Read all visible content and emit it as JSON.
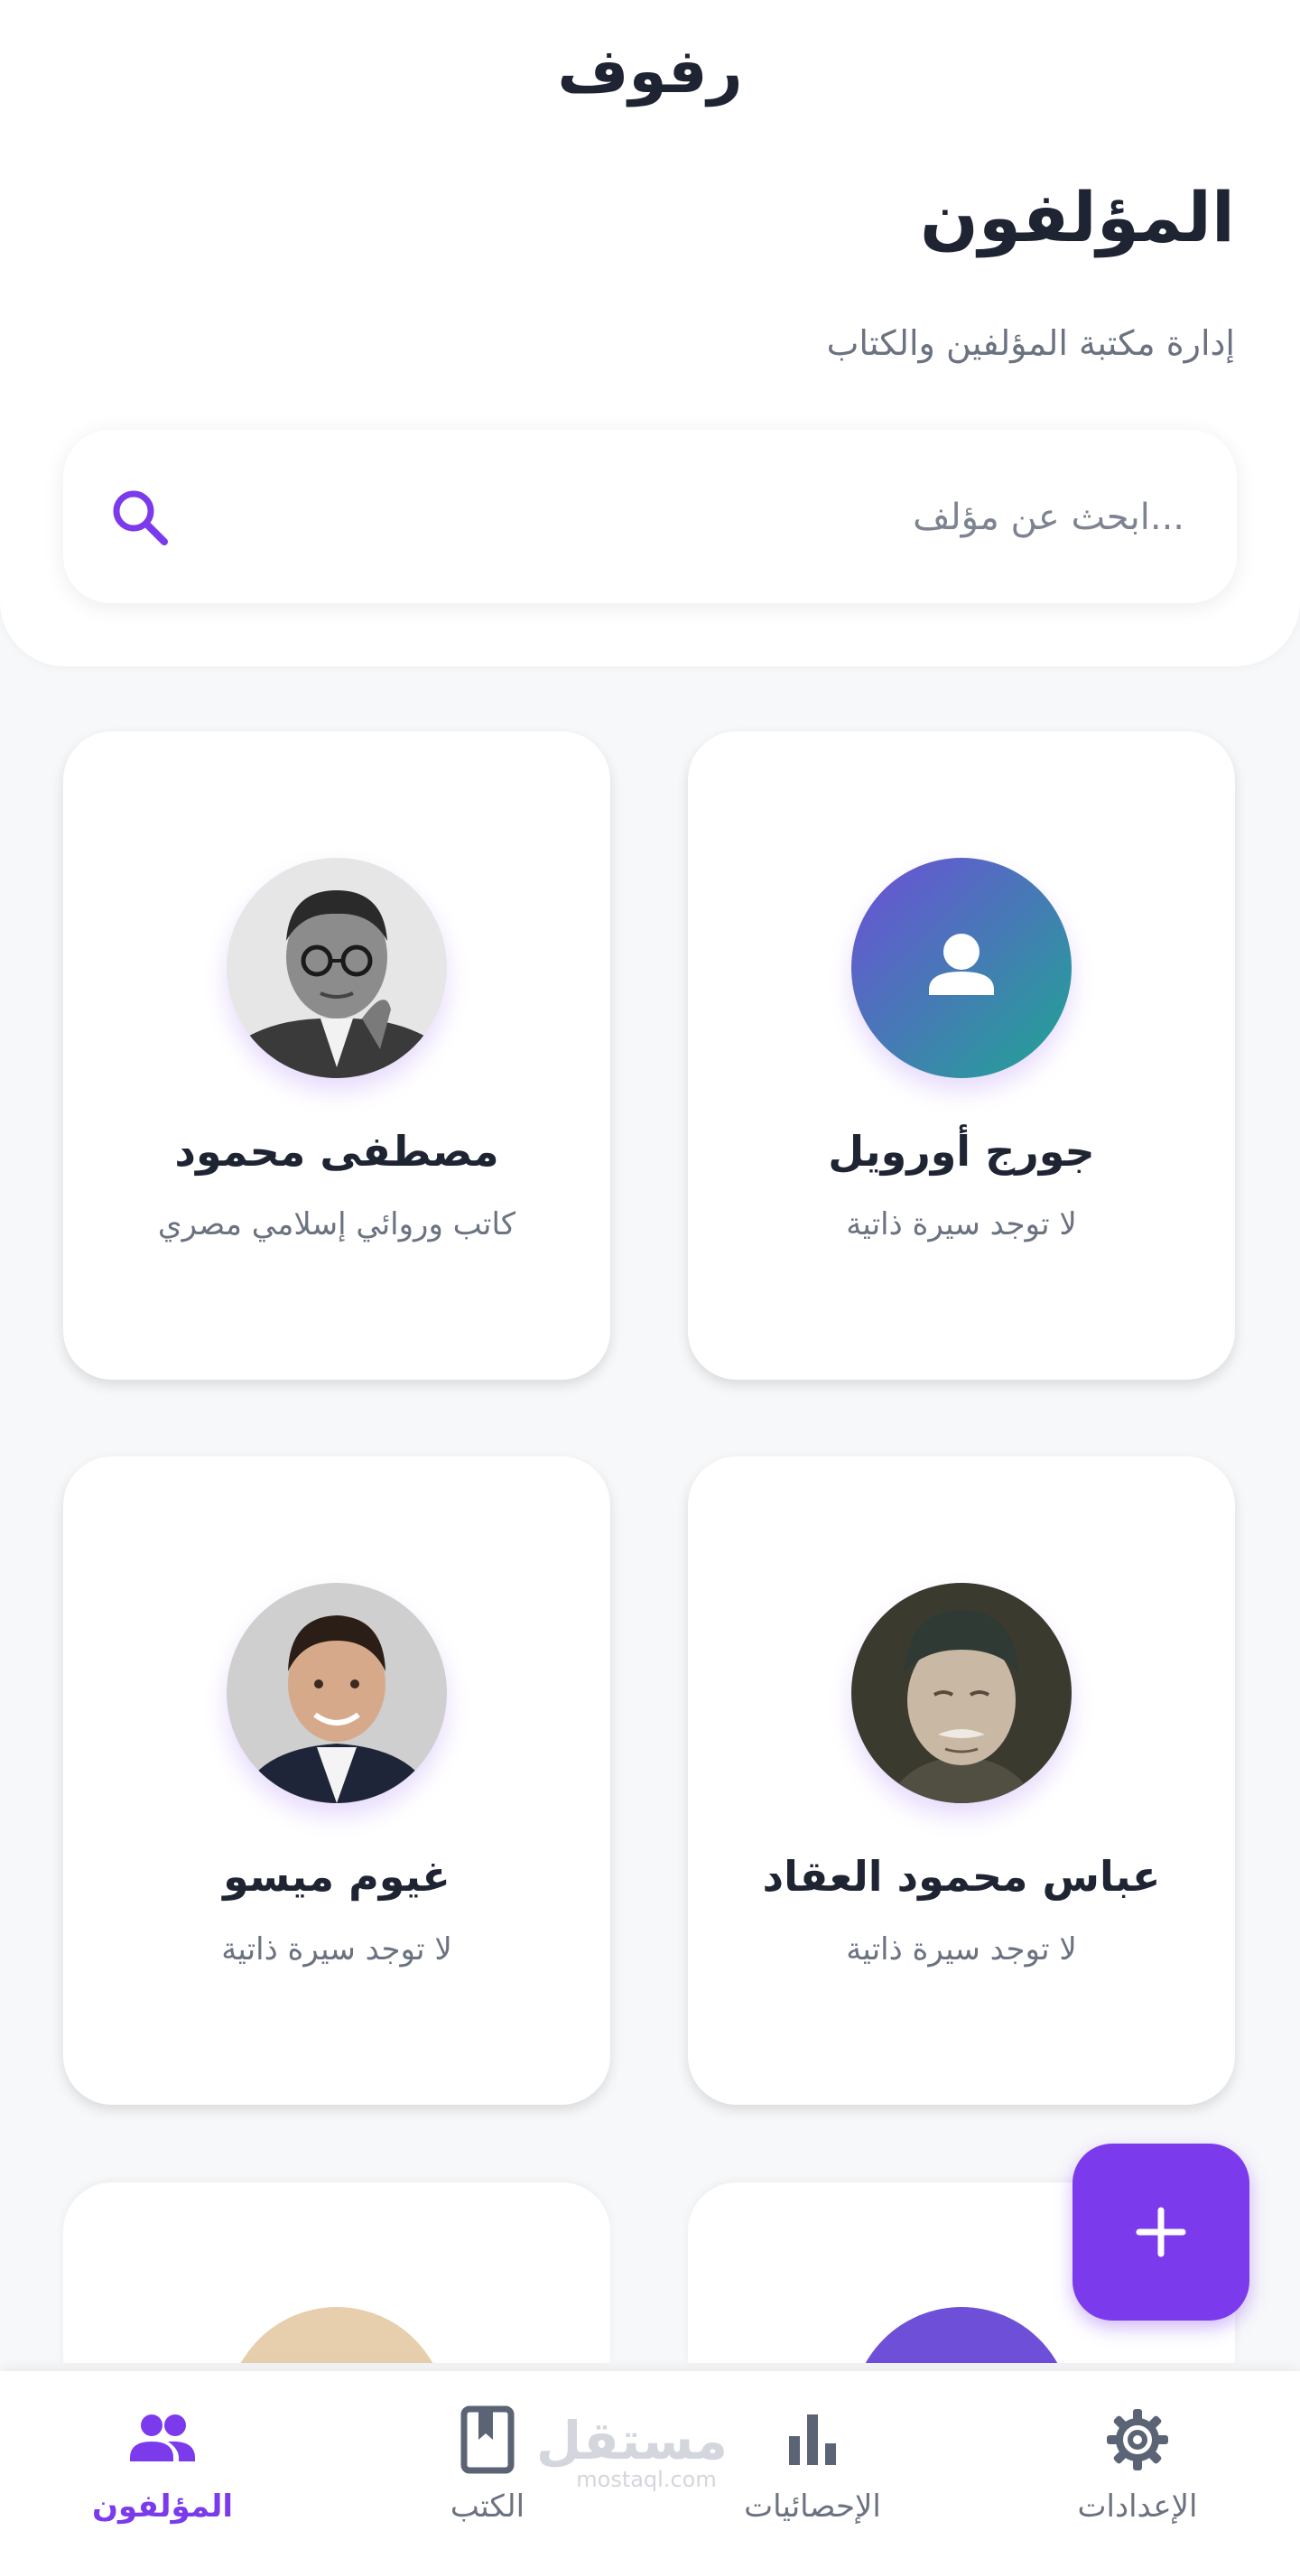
{
  "app": {
    "title": "رفوف"
  },
  "page": {
    "title": "المؤلفون",
    "subtitle": "إدارة مكتبة المؤلفين والكتاب"
  },
  "search": {
    "placeholder": "...ابحث عن مؤلف"
  },
  "authors": [
    {
      "name": "جورج أورويل",
      "bio": "لا توجد سيرة ذاتية",
      "avatar": "placeholder-person-icon"
    },
    {
      "name": "مصطفى محمود",
      "bio": "كاتب وروائي إسلامي مصري",
      "avatar": "photo"
    },
    {
      "name": "عباس محمود العقاد",
      "bio": "لا توجد سيرة ذاتية",
      "avatar": "photo"
    },
    {
      "name": "غيوم ميسو",
      "bio": "لا توجد سيرة ذاتية",
      "avatar": "photo"
    }
  ],
  "fab": {
    "icon": "plus-icon"
  },
  "bottom_nav": [
    {
      "label": "الإعدادات",
      "icon": "gear-icon",
      "active": false
    },
    {
      "label": "الإحصائيات",
      "icon": "bar-chart-icon",
      "active": false
    },
    {
      "label": "الكتب",
      "icon": "book-icon",
      "active": false
    },
    {
      "label": "المؤلفون",
      "icon": "people-icon",
      "active": true
    }
  ],
  "watermark": {
    "text": "مستقل",
    "subtext": "mostaql.com"
  },
  "colors": {
    "accent": "#7c3aed",
    "text_primary": "#1f2433",
    "text_secondary": "#6b7280",
    "avatar_gradient_start": "#6d4fd8",
    "avatar_gradient_end": "#1fa593"
  }
}
